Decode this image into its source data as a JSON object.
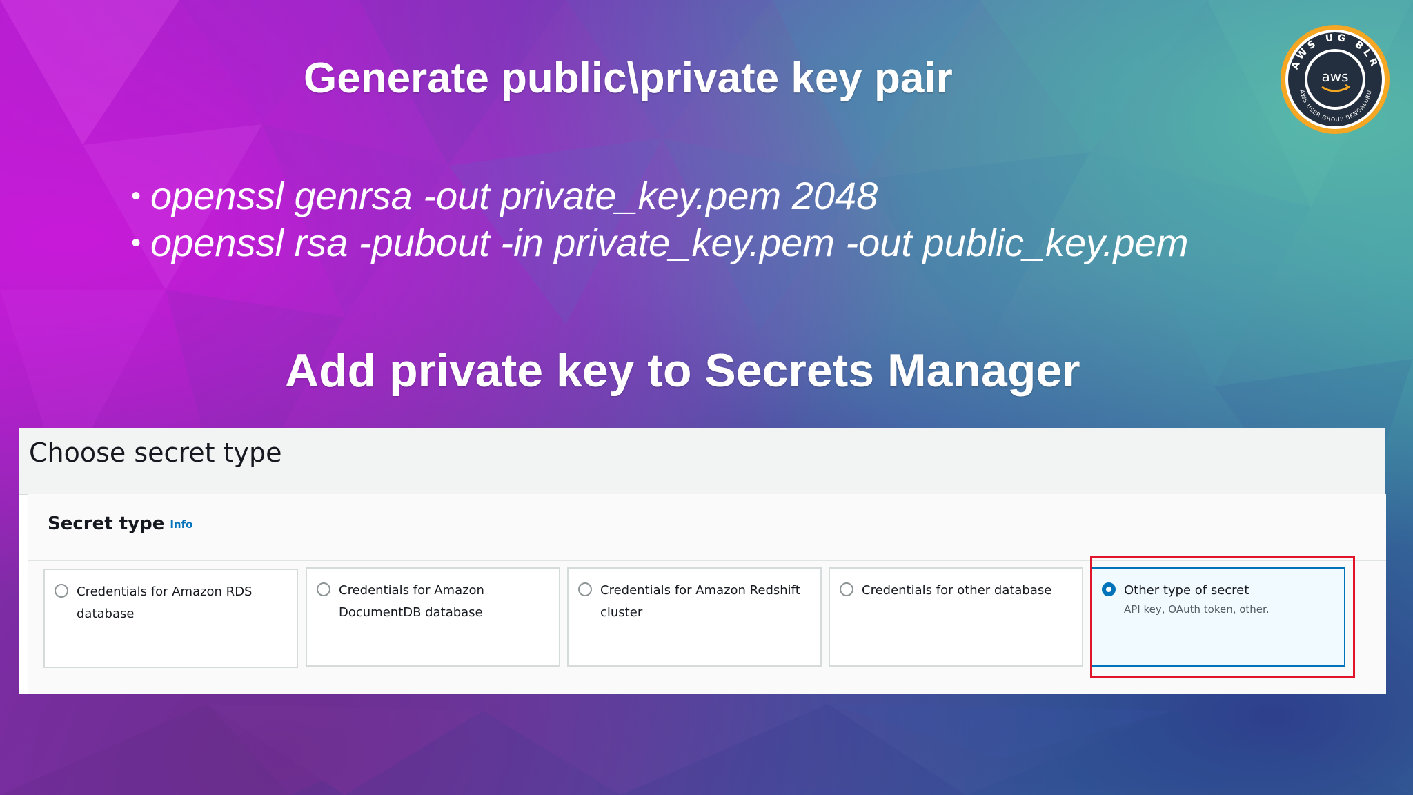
{
  "slide": {
    "heading_1": "Generate public\\private key pair",
    "commands": [
      "openssl genrsa -out private_key.pem 2048",
      "openssl rsa -pubout -in private_key.pem -out public_key.pem"
    ],
    "bullet": "•",
    "heading_2": "Add private key to Secrets Manager",
    "logo": {
      "ring_text": "AWS UG BLR",
      "center_text": "aws",
      "subtext": "AWS USER GROUP BENGALURU",
      "ring_color": "#f5a623",
      "inner_color": "#232f3e"
    }
  },
  "console": {
    "page_title": "Choose secret type",
    "section_title": "Secret type",
    "info_link": "Info",
    "options": [
      {
        "label": "Credentials for Amazon RDS database",
        "description": "",
        "selected": false
      },
      {
        "label": "Credentials for Amazon DocumentDB database",
        "description": "",
        "selected": false
      },
      {
        "label": "Credentials for Amazon Redshift cluster",
        "description": "",
        "selected": false
      },
      {
        "label": "Credentials for other database",
        "description": "",
        "selected": false
      },
      {
        "label": "Other type of secret",
        "description": "API key, OAuth token, other.",
        "selected": true
      }
    ],
    "highlight_color": "#e0142a",
    "accent_color": "#0073bb"
  }
}
